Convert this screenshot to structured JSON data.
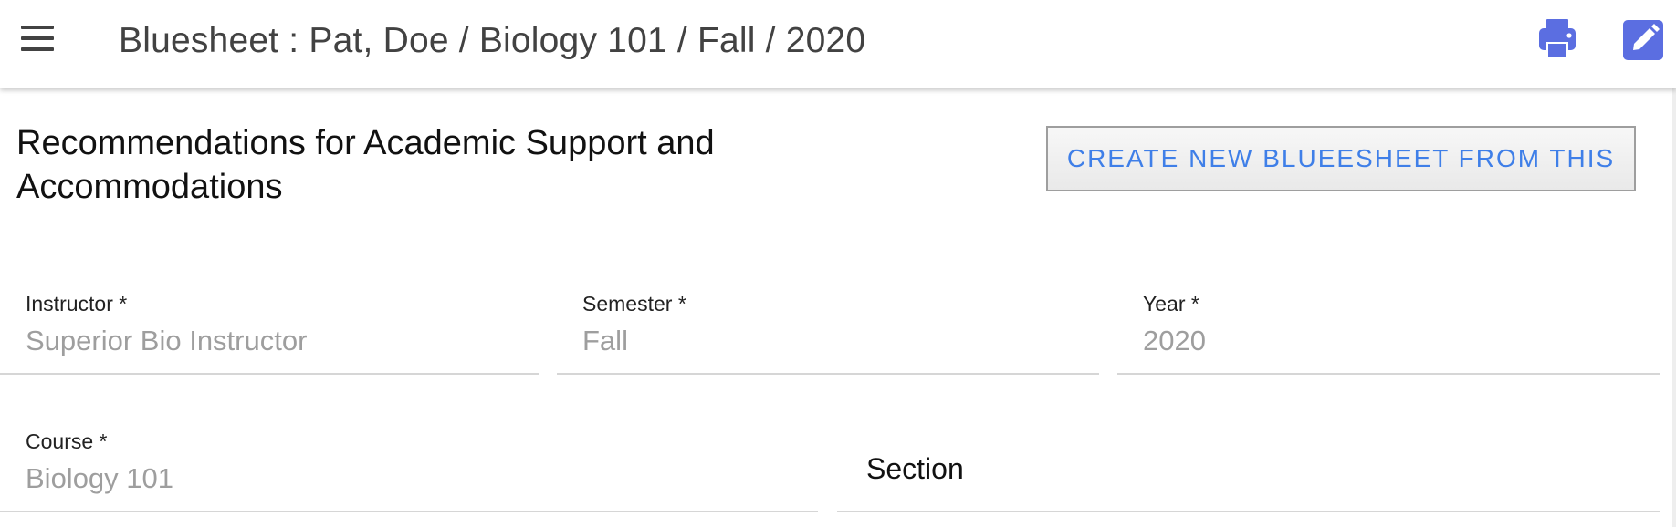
{
  "app_bar": {
    "title": "Bluesheet : Pat, Doe / Biology 101 / Fall / 2020",
    "menu_icon": "menu-icon",
    "print_icon": "print-icon",
    "edit_icon": "edit-icon",
    "accent_color": "#5b6ee1"
  },
  "main": {
    "heading": "Recommendations for Academic Support and Accommodations",
    "create_button_label": "CREATE NEW BLUEESHEET FROM THIS",
    "create_button_color": "#3f7fe8"
  },
  "form": {
    "instructor": {
      "label": "Instructor *",
      "value": "Superior Bio Instructor"
    },
    "semester": {
      "label": "Semester *",
      "value": "Fall"
    },
    "year": {
      "label": "Year *",
      "value": "2020"
    },
    "course": {
      "label": "Course *",
      "value": "Biology 101"
    },
    "section": {
      "label": "Section"
    }
  }
}
